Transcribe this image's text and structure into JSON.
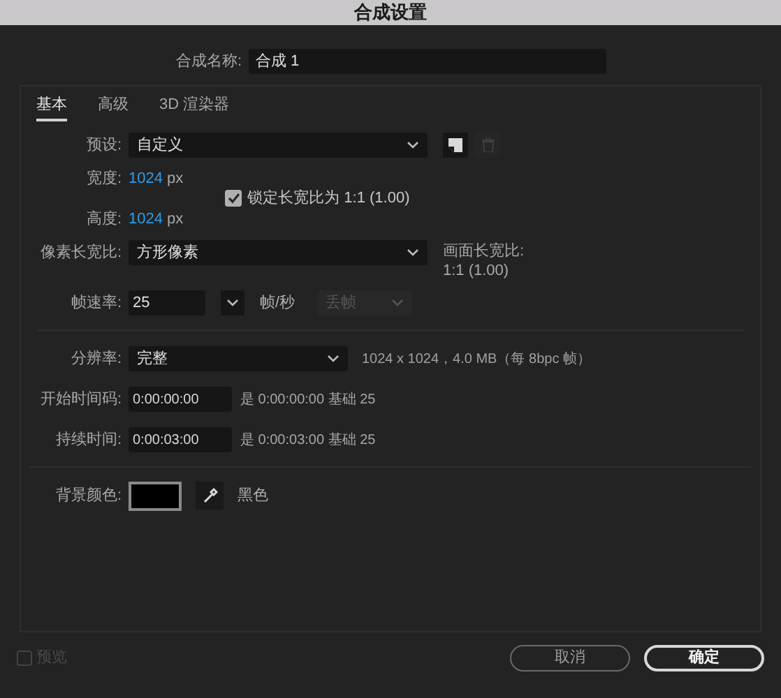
{
  "window": {
    "title": "合成设置"
  },
  "name_field": {
    "label": "合成名称:",
    "value": "合成 1"
  },
  "tabs": [
    {
      "label": "基本",
      "selected": true
    },
    {
      "label": "高级",
      "selected": false
    },
    {
      "label": "3D 渲染器",
      "selected": false
    }
  ],
  "preset": {
    "label": "预设:",
    "value": "自定义"
  },
  "width": {
    "label": "宽度:",
    "value": "1024",
    "unit": "px"
  },
  "height": {
    "label": "高度:",
    "value": "1024",
    "unit": "px"
  },
  "lock_aspect": {
    "label": "锁定长宽比为 1:1 (1.00)",
    "checked": true
  },
  "pixel_aspect": {
    "label": "像素长宽比:",
    "value": "方形像素"
  },
  "frame_aspect": {
    "label": "画面长宽比:",
    "value": "1:1 (1.00)"
  },
  "frame_rate": {
    "label": "帧速率:",
    "value": "25",
    "unit": "帧/秒",
    "drop_frame": {
      "value": "丢帧",
      "disabled": true
    }
  },
  "resolution": {
    "label": "分辨率:",
    "value": "完整",
    "info": "1024 x 1024，4.0 MB（每 8bpc 帧）"
  },
  "start_timecode": {
    "label": "开始时间码:",
    "value": "0:00:00:00",
    "info": "是 0:00:00:00 基础 25"
  },
  "duration": {
    "label": "持续时间:",
    "value": "0:00:03:00",
    "info": "是 0:00:03:00 基础 25"
  },
  "background_color": {
    "label": "背景颜色:",
    "color": "#000000",
    "name": "黑色"
  },
  "preview": {
    "label": "预览",
    "checked": false,
    "disabled": true
  },
  "buttons": [
    {
      "label": "取消",
      "kind": "cancel"
    },
    {
      "label": "确定",
      "kind": "ok"
    }
  ]
}
